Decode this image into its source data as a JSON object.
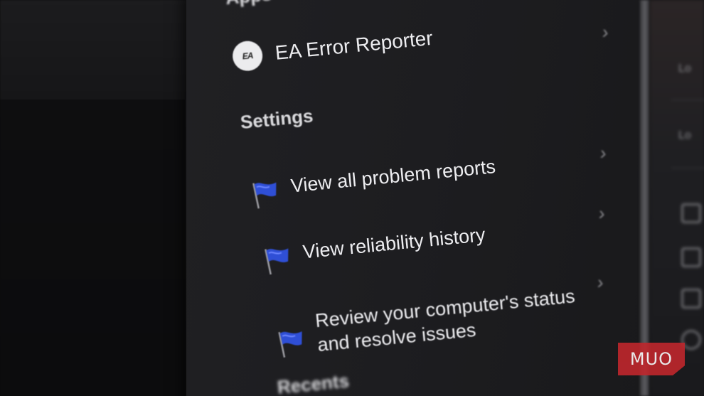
{
  "sections": {
    "apps_heading": "Apps",
    "settings_heading": "Settings",
    "recents_heading": "Recents"
  },
  "apps": {
    "items": [
      {
        "label": "EA Error Reporter",
        "icon": "ea-logo-icon",
        "logo_text": "EA"
      }
    ]
  },
  "settings": {
    "items": [
      {
        "label": "View all problem reports",
        "icon": "blue-flag-icon"
      },
      {
        "label": "View reliability history",
        "icon": "blue-flag-icon"
      },
      {
        "label_line1": "Review your computer's status",
        "label_line2": "and resolve issues",
        "icon": "blue-flag-icon"
      }
    ]
  },
  "watermark": {
    "text": "MUO"
  },
  "colors": {
    "background": "#1d1d20",
    "text": "#ededf0",
    "flag_blue": "#2f4fd6",
    "watermark_red": "#c0272d"
  }
}
